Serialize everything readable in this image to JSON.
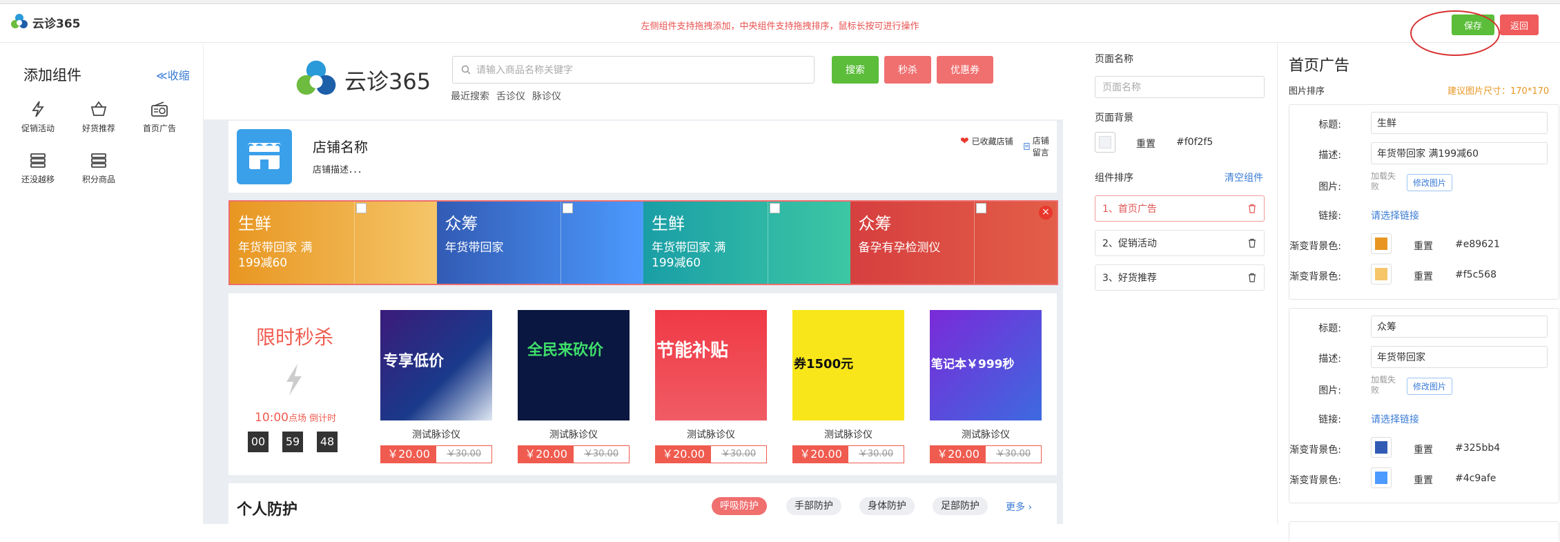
{
  "app": {
    "logo_text": "云诊365",
    "notice": "左侧组件支持拖拽添加，中央组件支持拖拽排序，鼠标长按可进行操作"
  },
  "header": {
    "save_label": "保存",
    "back_label": "返回"
  },
  "left_panel": {
    "title": "添加组件",
    "collapse_label": "≪收缩",
    "components": [
      {
        "label": "促销活动",
        "icon": "lightning-icon"
      },
      {
        "label": "好货推荐",
        "icon": "basket-icon"
      },
      {
        "label": "首页广告",
        "icon": "radio-icon"
      },
      {
        "label": "还没越移",
        "icon": "list-icon"
      },
      {
        "label": "积分商品",
        "icon": "list-icon"
      }
    ]
  },
  "preview": {
    "shop_logo_text": "云诊365",
    "search_placeholder": "请输入商品名称关键字",
    "search_button": "搜索",
    "flash_button": "秒杀",
    "coupon_button": "优惠券",
    "recent_label": "最近搜索",
    "recent_items": [
      "舌诊仪",
      "脉诊仪"
    ],
    "store": {
      "name": "店铺名称",
      "desc": "店铺描述．．．",
      "fav_label": "已收藏店铺",
      "msg_label": "店铺留言"
    },
    "ads": [
      {
        "title": "生鲜",
        "desc": "年货带回家 满199减60",
        "color_from": "#e89621",
        "color_to": "#f5c568"
      },
      {
        "title": "众筹",
        "desc": "年货带回家",
        "color_from": "#325bb4",
        "color_to": "#4c9afe"
      },
      {
        "title": "生鲜",
        "desc": "年货带回家 满199减60",
        "color_from": "#1a9ea6",
        "color_to": "#3cc7a4"
      },
      {
        "title": "众筹",
        "desc": "备孕有孕检测仪",
        "color_from": "#d63f3f",
        "color_to": "#e35e48"
      }
    ],
    "flash": {
      "title": "限时秒杀",
      "time": "10:00",
      "time_suffix": "点场 倒计时",
      "countdown": [
        "00",
        "59",
        "48"
      ],
      "products": [
        {
          "name": "测试脉诊仪",
          "price": "￥20.00",
          "old": "￥30.00",
          "img_text": "专享低价"
        },
        {
          "name": "测试脉诊仪",
          "price": "￥20.00",
          "old": "￥30.00",
          "img_text": "全民来砍价"
        },
        {
          "name": "测试脉诊仪",
          "price": "￥20.00",
          "old": "￥30.00",
          "img_text": "节能补贴"
        },
        {
          "name": "测试脉诊仪",
          "price": "￥20.00",
          "old": "￥30.00",
          "img_text": "券1500元"
        },
        {
          "name": "测试脉诊仪",
          "price": "￥20.00",
          "old": "￥30.00",
          "img_text": "笔记本￥999秒"
        }
      ]
    },
    "protection": {
      "title": "个人防护",
      "tabs": [
        "呼吸防护",
        "手部防护",
        "身体防护",
        "足部防护"
      ],
      "more": "更多"
    }
  },
  "middle_panel": {
    "page_name_label": "页面名称",
    "page_name_placeholder": "页面名称",
    "page_bg_label": "页面背景",
    "reset_label": "重置",
    "bg_value": "#f0f2f5",
    "sort_label": "组件排序",
    "clear_label": "清空组件",
    "sort_items": [
      "1、首页广告",
      "2、促销活动",
      "3、好货推荐"
    ]
  },
  "right_panel": {
    "title": "首页广告",
    "sort_label": "图片排序",
    "size_hint": "建议图片尺寸：170*170",
    "labels": {
      "title": "标题:",
      "desc": "描述:",
      "image": "图片:",
      "link": "链接:",
      "grad": "渐变背景色:",
      "reset": "重置",
      "add_img": "加载失败",
      "modify_img": "修改图片",
      "choose_link": "请选择链接"
    },
    "items": [
      {
        "title": "生鲜",
        "desc": "年货带回家 满199减60",
        "c1": "#e89621",
        "c2": "#f5c568"
      },
      {
        "title": "众筹",
        "desc": "年货带回家",
        "c1": "#325bb4",
        "c2": "#4c9afe"
      }
    ]
  }
}
